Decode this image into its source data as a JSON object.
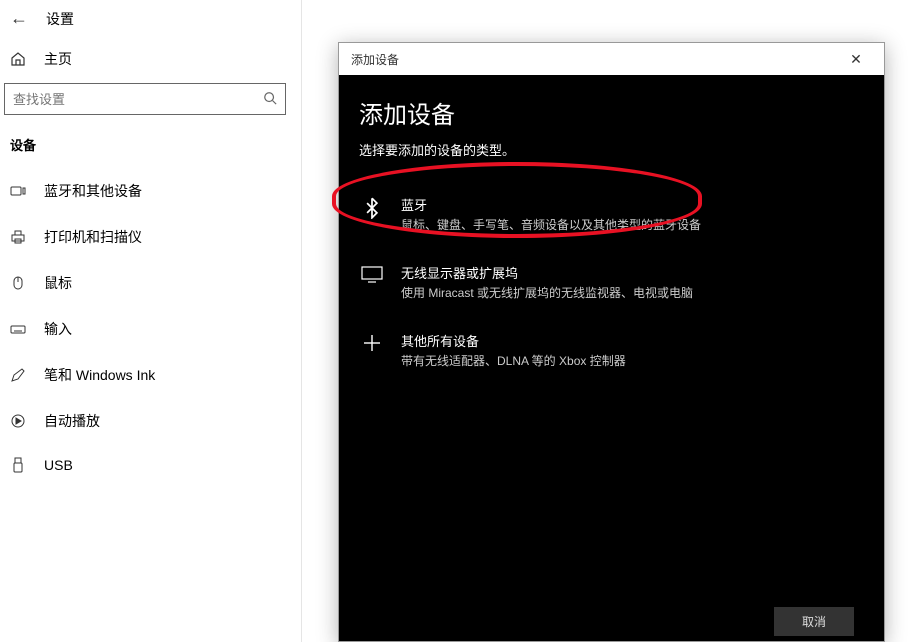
{
  "header": {
    "settings_label": "设置",
    "home_label": "主页"
  },
  "search": {
    "placeholder": "查找设置"
  },
  "category": {
    "title": "设备",
    "items": [
      {
        "label": "蓝牙和其他设备"
      },
      {
        "label": "打印机和扫描仪"
      },
      {
        "label": "鼠标"
      },
      {
        "label": "输入"
      },
      {
        "label": "笔和 Windows Ink"
      },
      {
        "label": "自动播放"
      },
      {
        "label": "USB"
      }
    ]
  },
  "dialog": {
    "titlebar": "添加设备",
    "heading": "添加设备",
    "subtitle": "选择要添加的设备的类型。",
    "options": [
      {
        "title": "蓝牙",
        "desc": "鼠标、键盘、手写笔、音频设备以及其他类型的蓝牙设备"
      },
      {
        "title": "无线显示器或扩展坞",
        "desc": "使用 Miracast 或无线扩展坞的无线监视器、电视或电脑"
      },
      {
        "title": "其他所有设备",
        "desc": "带有无线适配器、DLNA 等的 Xbox 控制器"
      }
    ],
    "cancel": "取消"
  }
}
